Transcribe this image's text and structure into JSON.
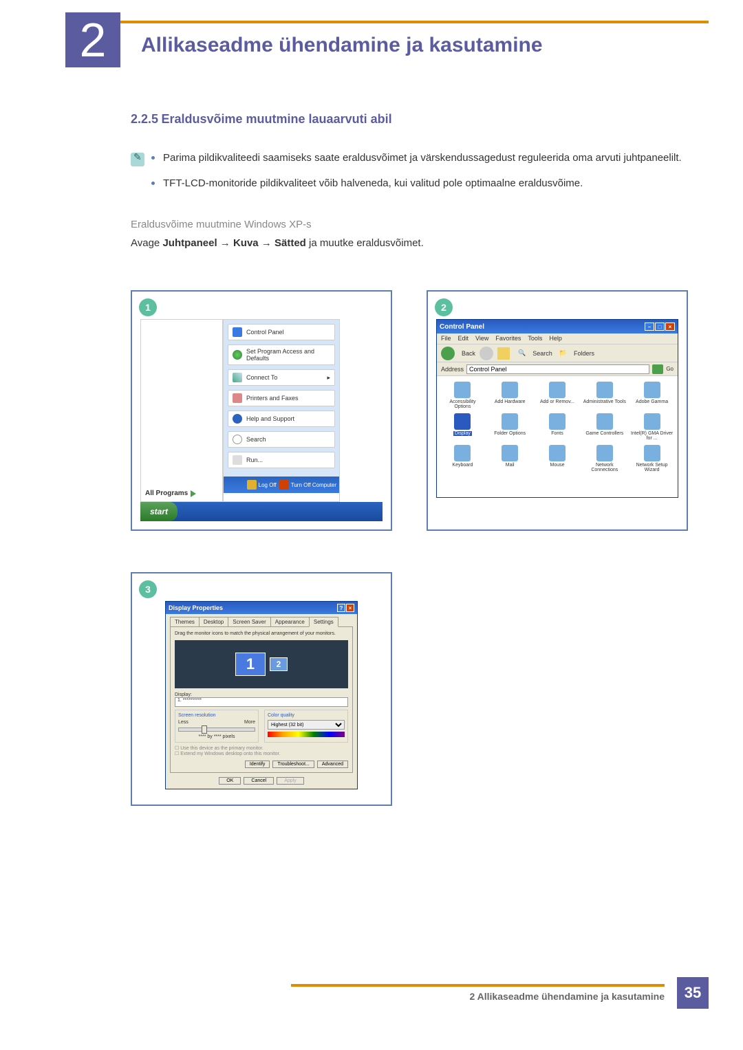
{
  "chapter": {
    "num": "2",
    "title": "Allikaseadme ühendamine ja kasutamine"
  },
  "section": {
    "num": "2.2.5",
    "title": "Eraldusvõime muutmine lauaarvuti abil"
  },
  "bullets": [
    "Parima pildikvaliteedi saamiseks saate eraldusvõimet ja värskendussagedust reguleerida oma arvuti juhtpaneelilt.",
    "TFT-LCD-monitoride pildikvaliteet võib halveneda, kui valitud pole optimaalne eraldusvõime."
  ],
  "sub_heading": "Eraldusvõime muutmine Windows XP-s",
  "body_parts": [
    "Avage ",
    "Juhtpaneel",
    " → ",
    "Kuva",
    " → ",
    "Sätted",
    " ja muutke eraldusvõimet."
  ],
  "fig_badges": [
    "1",
    "2",
    "3"
  ],
  "start_menu": {
    "items": [
      "Control Panel",
      "Set Program Access and Defaults",
      "Connect To",
      "Printers and Faxes",
      "Help and Support",
      "Search",
      "Run..."
    ],
    "all_programs": "All Programs",
    "logoff": "Log Off",
    "turnoff": "Turn Off Computer",
    "start": "start"
  },
  "cp_window": {
    "title": "Control Panel",
    "menus": [
      "File",
      "Edit",
      "View",
      "Favorites",
      "Tools",
      "Help"
    ],
    "tool_back": "Back",
    "tool_search": "Search",
    "tool_folders": "Folders",
    "addr_label": "Address",
    "addr_value": "Control Panel",
    "go": "Go",
    "icons": [
      "Accessibility Options",
      "Add Hardware",
      "Add or Remov...",
      "Administrative Tools",
      "Adobe Gamma",
      "Display",
      "Folder Options",
      "Fonts",
      "Game Controllers",
      "Intel(R) GMA Driver for ...",
      "Keyboard",
      "Mail",
      "Mouse",
      "Network Connections",
      "Network Setup Wizard"
    ],
    "selected_icon": "Display"
  },
  "dp_window": {
    "title": "Display Properties",
    "tabs": [
      "Themes",
      "Desktop",
      "Screen Saver",
      "Appearance",
      "Settings"
    ],
    "active_tab": "Settings",
    "drag_text": "Drag the monitor icons to match the physical arrangement of your monitors.",
    "display_label": "Display:",
    "display_value": "1. **********",
    "res_label": "Screen resolution",
    "res_less": "Less",
    "res_more": "More",
    "res_value": "**** by **** pixels",
    "color_label": "Color quality",
    "color_value": "Highest (32 bit)",
    "chk1": "Use this device as the primary monitor.",
    "chk2": "Extend my Windows desktop onto this monitor.",
    "btn_identify": "Identify",
    "btn_troubleshoot": "Troubleshoot...",
    "btn_advanced": "Advanced",
    "ok": "OK",
    "cancel": "Cancel",
    "apply": "Apply"
  },
  "footer": {
    "text": "2 Allikaseadme ühendamine ja kasutamine",
    "page": "35"
  }
}
